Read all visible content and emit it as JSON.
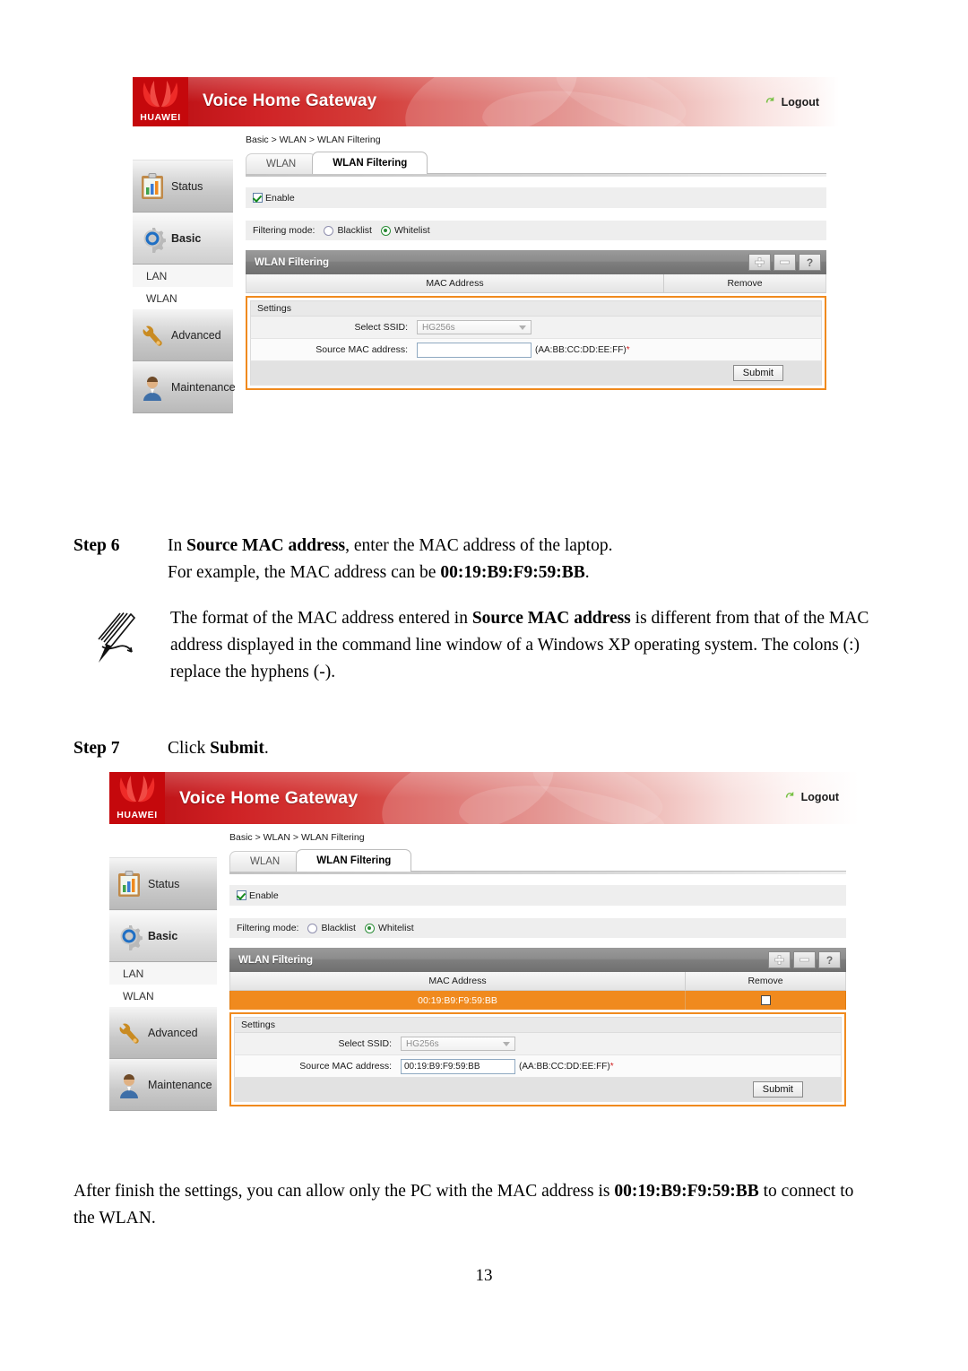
{
  "page": {
    "number": "13"
  },
  "router_ui": {
    "banner": {
      "brand": "HUAWEI",
      "title": "Voice Home Gateway",
      "logout_label": "Logout",
      "logout_icon": "undo-arrow-icon",
      "brand_color": "#c5080c"
    },
    "sidebar": {
      "items": [
        {
          "label": "Status",
          "icon": "clipboard-chart-icon",
          "active": false
        },
        {
          "label": "Basic",
          "icon": "gear-icon",
          "active": true
        },
        {
          "label": "LAN",
          "icon": "",
          "sub": true
        },
        {
          "label": "WLAN",
          "icon": "",
          "sub": true
        },
        {
          "label": "Advanced",
          "icon": "wrench-icon",
          "active": false
        },
        {
          "label": "Maintenance",
          "icon": "user-icon",
          "active": false
        }
      ]
    },
    "breadcrumb": "Basic > WLAN > WLAN Filtering",
    "tabs": [
      {
        "label": "WLAN",
        "active": false
      },
      {
        "label": "WLAN Filtering",
        "active": true
      }
    ],
    "enable": {
      "label": "Enable",
      "checked": true
    },
    "filtering_mode": {
      "label": "Filtering mode:",
      "options": [
        {
          "label": "Blacklist",
          "selected": false
        },
        {
          "label": "Whitelist",
          "selected": true
        }
      ]
    },
    "panel": {
      "title": "WLAN Filtering",
      "buttons": [
        {
          "name": "add-button",
          "glyph": "plus-icon"
        },
        {
          "name": "remove-button",
          "glyph": "minus-icon"
        },
        {
          "name": "help-button",
          "glyph": "question-icon",
          "text": "?"
        }
      ],
      "columns": [
        "MAC Address",
        "Remove"
      ],
      "rows_empty": [],
      "rows_filled": [
        {
          "mac": "00:19:B9:F9:59:BB",
          "remove_checked": false
        }
      ],
      "row_highlight_color": "#f08a1e"
    },
    "settings": {
      "title": "Settings",
      "select_ssid_label": "Select SSID:",
      "select_ssid_value": "HG256s",
      "source_mac_label": "Source MAC address:",
      "source_mac_value_empty": "",
      "source_mac_value_filled": "00:19:B9:F9:59:BB",
      "source_mac_placeholder": "",
      "format_hint": "(AA:BB:CC:DD:EE:FF)",
      "format_hint_star": "*",
      "submit_label": "Submit"
    }
  },
  "document": {
    "step6": {
      "label": "Step 6",
      "line1_pre": "In ",
      "line1_bold": "Source MAC address",
      "line1_post": ", enter the MAC address of the laptop.",
      "line2_pre": "For example, the MAC address can be ",
      "line2_bold": "00:19:B9:F9:59:BB",
      "line2_post": "."
    },
    "note": {
      "icon": "pen-note-icon",
      "pre": "The format of the MAC address entered in ",
      "bold": "Source MAC address",
      "post": " is different from that of the MAC address displayed in the command line window of a Windows XP operating system. The colons (:) replace the hyphens (-)."
    },
    "step7": {
      "label": "Step 7",
      "pre": "Click ",
      "bold": "Submit",
      "post": "."
    },
    "closing": {
      "pre": "After finish the settings, you can allow only the PC with the MAC address is ",
      "bold": "00:19:B9:F9:59:BB",
      "post": " to connect to the WLAN."
    }
  }
}
